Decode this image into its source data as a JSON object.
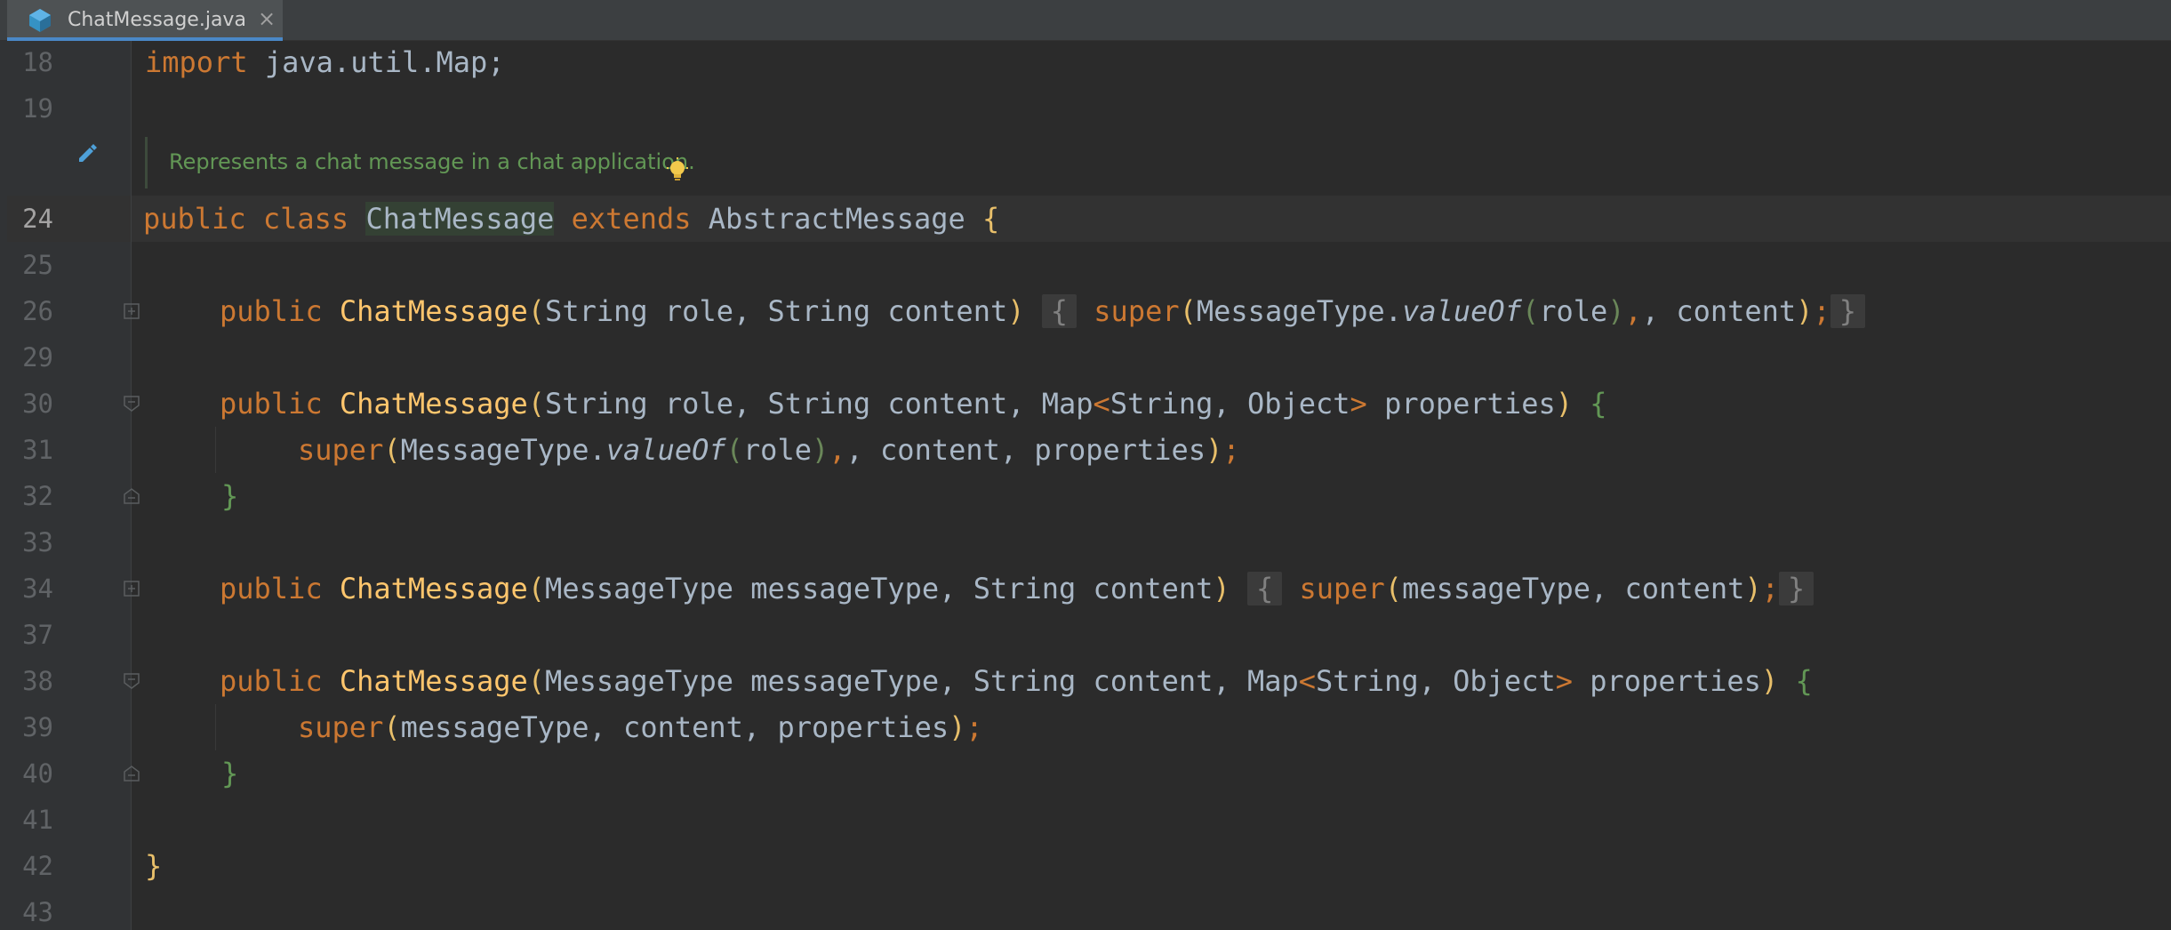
{
  "tab": {
    "filename": "ChatMessage.java",
    "close_glyph": "×",
    "icon": "java-class-icon"
  },
  "editor": {
    "caret_line": "24",
    "doc_comment": "Represents a chat message in a chat application.",
    "line_numbers": [
      "18",
      "19",
      "24",
      "25",
      "26",
      "29",
      "30",
      "31",
      "32",
      "33",
      "34",
      "37",
      "38",
      "39",
      "40",
      "41",
      "42",
      "43"
    ],
    "tokens": {
      "import_kw": "import",
      "import_path": " java.util.Map;",
      "public": "public",
      "class": "class",
      "class_name": "ChatMessage",
      "extends": "extends",
      "super_class": "AbstractMessage",
      "open_brace": "{",
      "close_brace": "}",
      "method_name": "ChatMessage",
      "super_kw": "super",
      "l26_params": "String role, String content",
      "l26_body_a": "MessageType.",
      "value_of": "valueOf",
      "role": "role",
      "l26_body_b": ", content",
      "l30_params_a": "String role, String content, Map",
      "lt": "<",
      "gt": ">",
      "generic_args": "String, Object",
      "properties": " properties",
      "l31_body_b": ", content, properties",
      "l34_params": "MessageType messageType, String content",
      "l34_body": "messageType, content",
      "l38_params_a": "MessageType messageType, String content, Map",
      "l39_body": "messageType, content, properties",
      "paren_open": "(",
      "paren_close": ")",
      "semicolon": ";",
      "comma": ",",
      "fold_open": "{",
      "fold_close": "}"
    }
  },
  "colors": {
    "background": "#2b2b2b",
    "keyword": "#cc7832",
    "method": "#ffc66d",
    "plain": "#a9b7c6",
    "doc": "#629755",
    "tab_underline": "#4a88c7"
  }
}
